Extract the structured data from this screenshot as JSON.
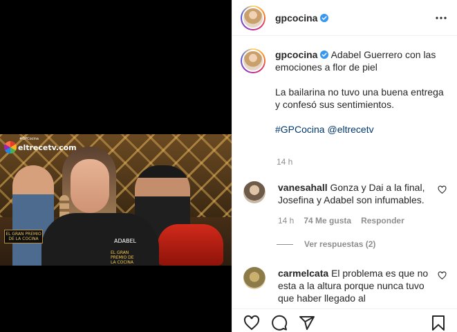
{
  "media": {
    "channel_logo": "eltrecetv.com",
    "channel_tag": "#GPCocina",
    "show_logo": "EL GRAN PREMIO DE LA COCINA",
    "badge_name": "ADABEL",
    "badge_show": "EL GRAN PREMIO DE LA COCINA"
  },
  "post": {
    "username": "gpcocina",
    "caption": {
      "text1": "Adabel Guerrero con las emociones a flor de piel",
      "text2": "La bailarina no tuvo una buena entrega y confesó sus sentimientos.",
      "tags": "#GPCocina @eltrecetv",
      "time": "14 h"
    }
  },
  "comments": [
    {
      "username": "vanesahall",
      "text": "Gonza y Dai a la final, Josefina y Adabel son infumables.",
      "time": "14 h",
      "likes": "74 Me gusta",
      "reply": "Responder",
      "view_replies": "Ver respuestas (2)"
    },
    {
      "username": "carmelcata",
      "text": "El problema es que no esta a la altura porque nunca tuvo que haber llegado al"
    }
  ],
  "icons": {
    "verified": "verified-badge-icon",
    "more": "more-options-icon",
    "like": "heart-icon",
    "comment": "comment-icon",
    "share": "share-icon",
    "save": "bookmark-icon"
  },
  "colors": {
    "verified": "#3897f0",
    "link": "#00376b",
    "muted": "#8e8e8e"
  }
}
